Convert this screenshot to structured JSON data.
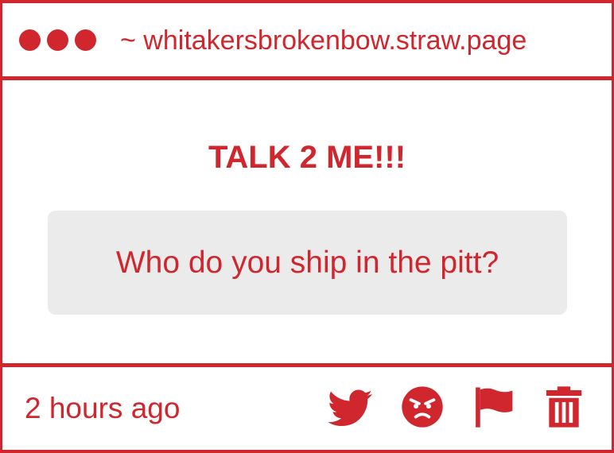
{
  "header": {
    "url": "~ whitakersbrokenbow.straw.page"
  },
  "main": {
    "heading": "TALK 2 ME!!!",
    "question": "Who do you ship in the pitt?"
  },
  "footer": {
    "timestamp": "2 hours ago",
    "icons": [
      "twitter-icon",
      "angry-face-icon",
      "flag-icon",
      "trash-icon"
    ]
  },
  "colors": {
    "accent": "#d0262d",
    "box_background": "#ebebec",
    "background": "#ffffff"
  }
}
